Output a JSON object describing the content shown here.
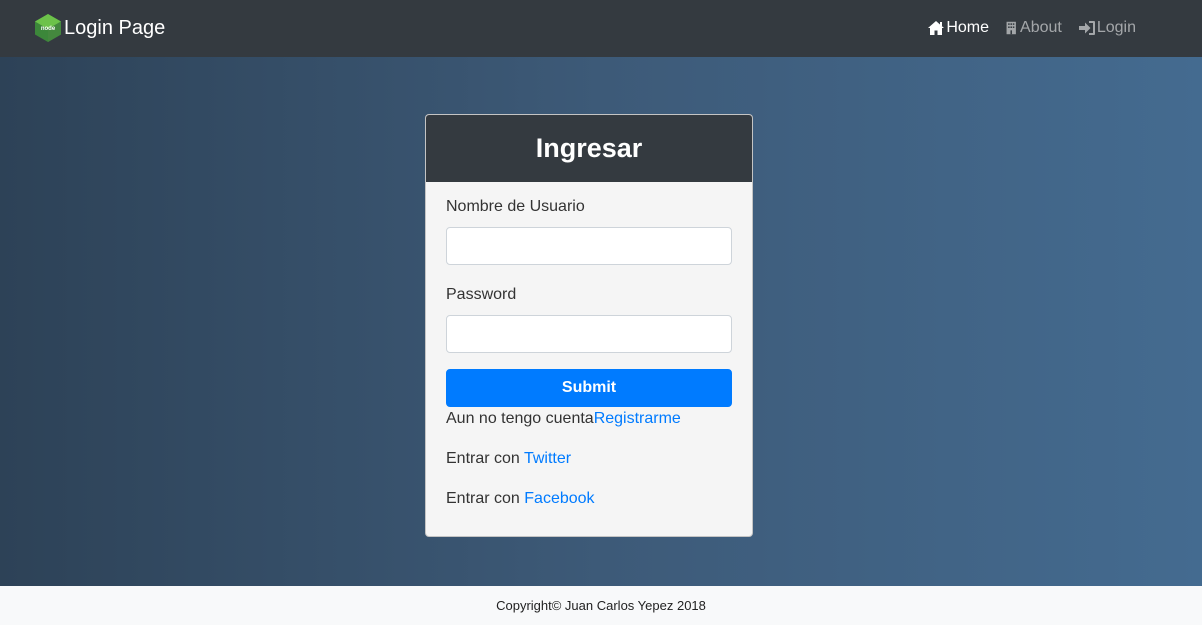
{
  "navbar": {
    "brand_text": "Login Page",
    "logo_icon": "nodejs-hexagon-icon",
    "logo_text": "node",
    "links": [
      {
        "label": "Home",
        "icon": "home-icon",
        "active": true
      },
      {
        "label": "About",
        "icon": "building-icon",
        "active": false
      },
      {
        "label": "Login",
        "icon": "sign-in-icon",
        "active": false
      }
    ]
  },
  "card": {
    "title": "Ingresar",
    "username_label": "Nombre de Usuario",
    "username_value": "",
    "password_label": "Password",
    "password_value": "",
    "submit_label": "Submit",
    "register_text": "Aun no tengo cuenta",
    "register_link": "Registrarme",
    "twitter_text": "Entrar con",
    "twitter_link": "Twitter",
    "facebook_text": "Entrar con",
    "facebook_link": "Facebook"
  },
  "footer": {
    "copyright": "Copyright© Juan Carlos Yepez 2018"
  },
  "colors": {
    "navbar_bg": "#343a40",
    "primary": "#007bff",
    "card_bg": "#f5f5f5",
    "gradient_start": "#2d4257",
    "gradient_end": "#446b90",
    "footer_bg": "#f8f9fa"
  }
}
